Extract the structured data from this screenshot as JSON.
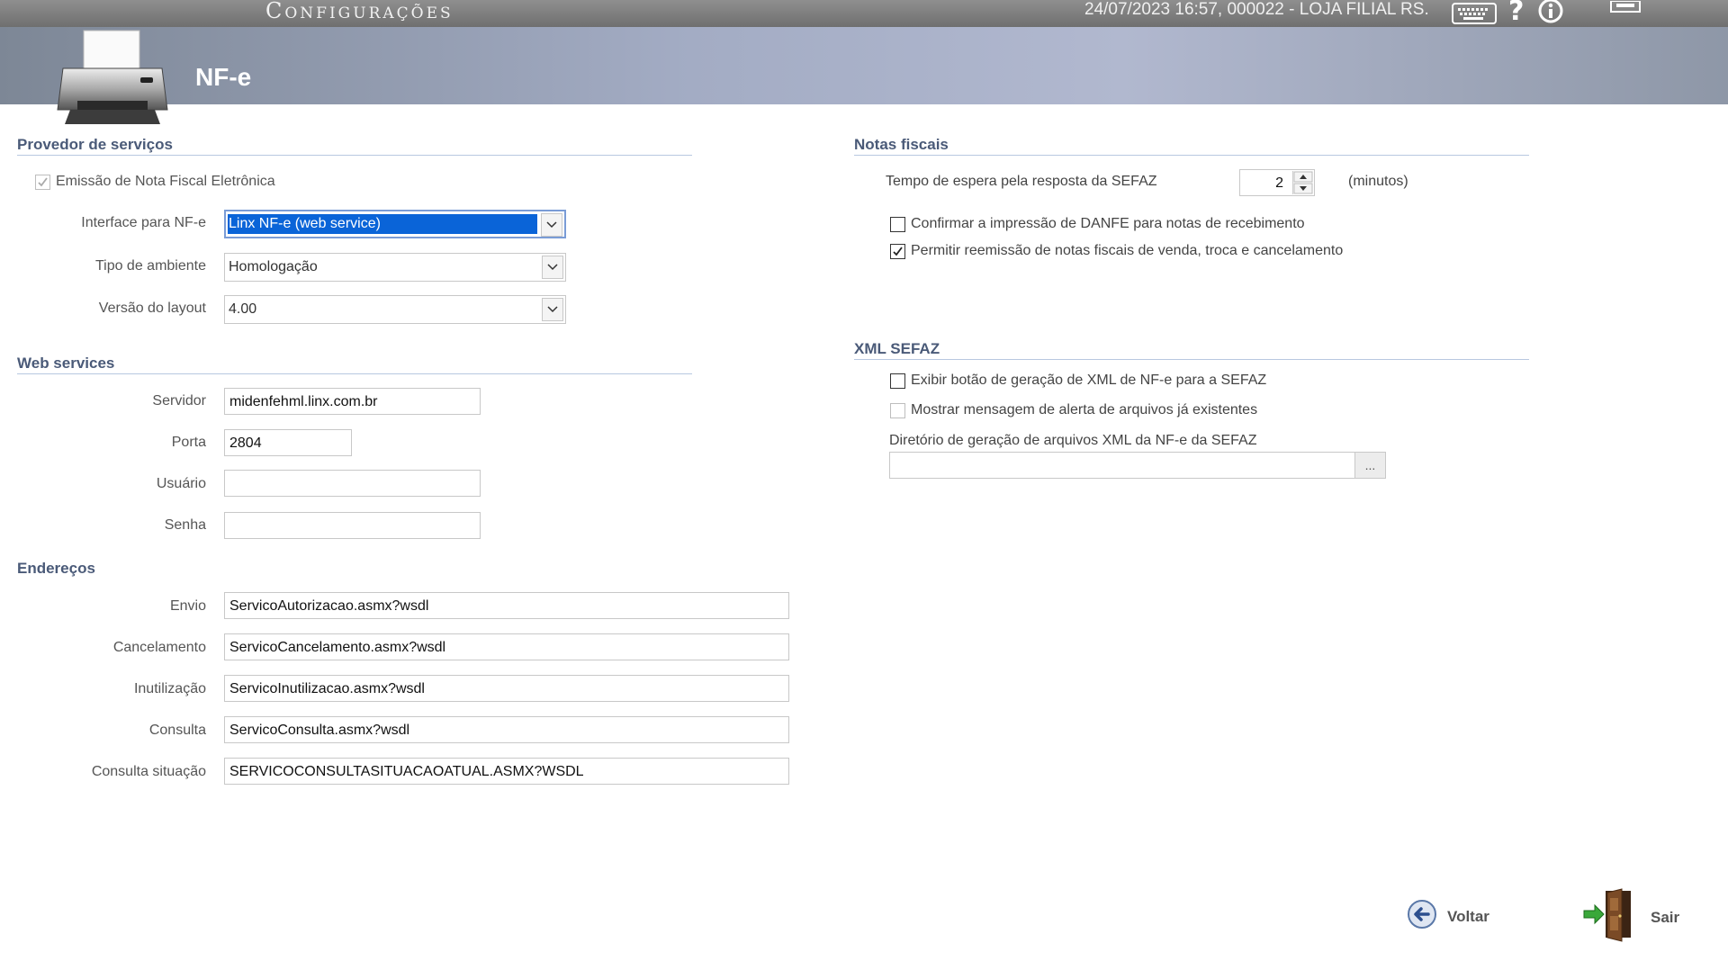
{
  "topbar": {
    "app_title": "Configurações",
    "datetime_store": "24/07/2023 16:57, 000022 - LOJA FILIAL RS."
  },
  "header": {
    "title": "NF-e"
  },
  "provedor": {
    "title": "Provedor de serviços",
    "emissao_label": "Emissão de Nota Fiscal Eletrônica",
    "emissao_checked": true,
    "interface_label": "Interface para NF-e",
    "interface_value": "Linx NF-e (web service)",
    "ambiente_label": "Tipo de ambiente",
    "ambiente_value": "Homologação",
    "layout_label": "Versão do layout",
    "layout_value": "4.00"
  },
  "webservices": {
    "title": "Web services",
    "servidor_label": "Servidor",
    "servidor_value": "midenfehml.linx.com.br",
    "porta_label": "Porta",
    "porta_value": "2804",
    "usuario_label": "Usuário",
    "usuario_value": "",
    "senha_label": "Senha",
    "senha_value": ""
  },
  "enderecos": {
    "title": "Endereços",
    "envio_label": "Envio",
    "envio_value": "ServicoAutorizacao.asmx?wsdl",
    "cancelamento_label": "Cancelamento",
    "cancelamento_value": "ServicoCancelamento.asmx?wsdl",
    "inutilizacao_label": "Inutilização",
    "inutilizacao_value": "ServicoInutilizacao.asmx?wsdl",
    "consulta_label": "Consulta",
    "consulta_value": "ServicoConsulta.asmx?wsdl",
    "situacao_label": "Consulta situação",
    "situacao_value": "SERVICOCONSULTASITUACAOATUAL.ASMX?WSDL"
  },
  "notas": {
    "title": "Notas fiscais",
    "tempo_label": "Tempo de espera pela resposta da SEFAZ",
    "tempo_value": "2",
    "tempo_unit": "(minutos)",
    "confirmar_label": "Confirmar a impressão de DANFE para notas de recebimento",
    "confirmar_checked": false,
    "permitir_label": "Permitir reemissão de notas fiscais de venda, troca e cancelamento",
    "permitir_checked": true
  },
  "xml": {
    "title": "XML SEFAZ",
    "exibir_label": "Exibir botão de geração de XML de NF-e para a SEFAZ",
    "exibir_checked": false,
    "mostrar_label": "Mostrar mensagem de alerta de arquivos já existentes",
    "mostrar_checked": false,
    "diretorio_label": "Diretório de geração de arquivos XML da NF-e da SEFAZ",
    "diretorio_value": "",
    "browse_label": "..."
  },
  "footer": {
    "voltar": "Voltar",
    "sair": "Sair"
  },
  "colors": {
    "accent_blue": "#0a64d8",
    "section_title": "#4a5a78",
    "header_bg": "#a3acc4"
  }
}
